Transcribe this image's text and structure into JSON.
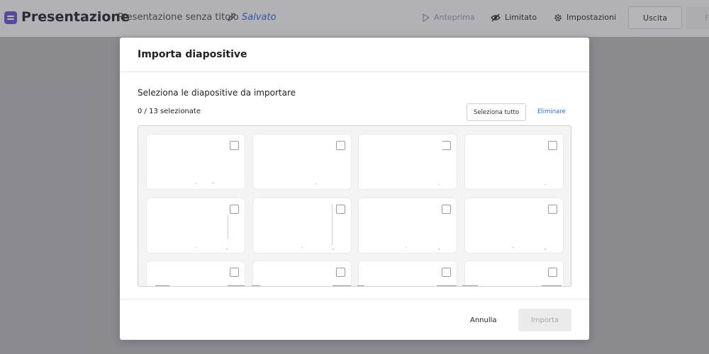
{
  "topbar": {
    "app_title": "Presentazione",
    "doc_title": "Presentazione senza titolo",
    "save_status": "Salvato",
    "preview_label": "Anteprima",
    "visibility_label": "Limitato",
    "settings_label": "Impostazioni",
    "exit_label": "Uscita",
    "partial_label": "F",
    "brand_color": "#6d5bd0",
    "save_color": "#3a6bd6",
    "icons": {
      "app": "presentation-icon",
      "edit": "pencil-icon",
      "preview": "play-icon",
      "visibility": "eye-off-icon",
      "settings": "gear-icon"
    }
  },
  "modal": {
    "title": "Importa diapositive",
    "subtitle": "Seleziona le diapositive da importare",
    "selection_count": "0 / 13 selezionate",
    "select_all_label": "Seleziona tutto",
    "clear_label": "Eliminare",
    "cancel_label": "Annulla",
    "import_label": "Importa",
    "link_color": "#2f6fd6",
    "visible_slide_thumbnails": 12,
    "slides_checked": [
      false,
      false,
      false,
      false,
      false,
      false,
      false,
      false,
      false,
      false,
      false,
      false
    ]
  }
}
